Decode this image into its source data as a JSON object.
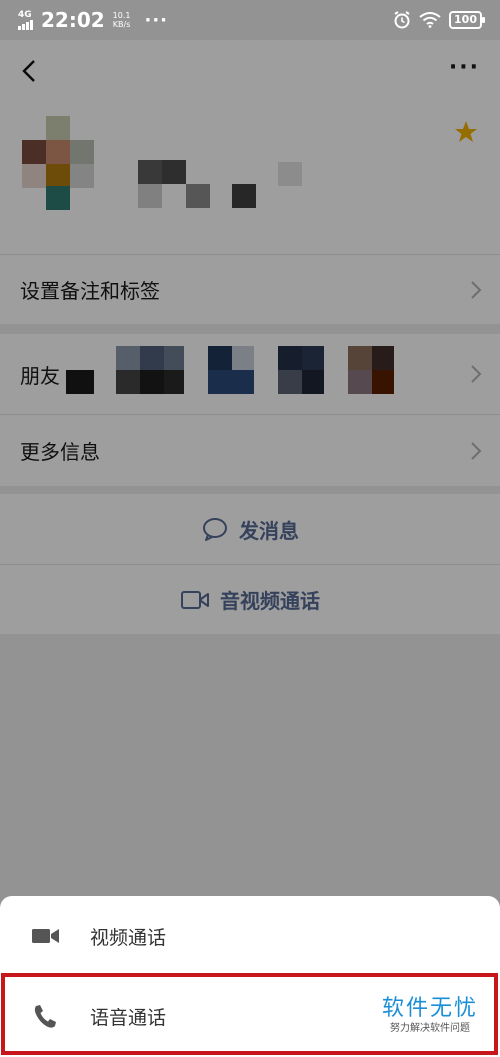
{
  "status_bar": {
    "network": "4G",
    "hd": "HD",
    "time": "22:02",
    "speed_value": "10.1",
    "speed_unit": "KB/s",
    "more": "···",
    "battery": "100"
  },
  "header": {
    "more_label": "···"
  },
  "rows": {
    "remark_label": "设置备注和标签",
    "moments_label": "朋友",
    "more_info_label": "更多信息"
  },
  "actions": {
    "send_message": "发消息",
    "av_call": "音视频通话"
  },
  "sheet": {
    "video_call": "视频通话",
    "voice_call": "语音通话"
  },
  "watermark": {
    "main": "软件无忧",
    "sub": "努力解决软件问题"
  },
  "colors": {
    "accent": "#576b95",
    "highlight": "#c8161d",
    "star": "#f2b100"
  }
}
